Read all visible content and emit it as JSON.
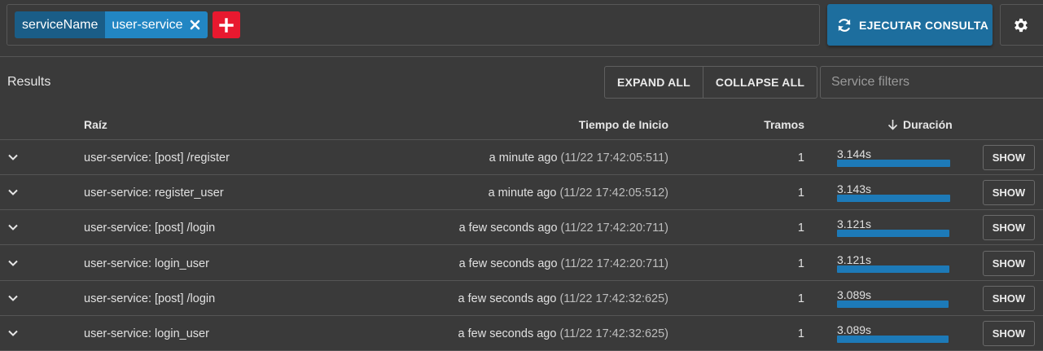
{
  "query": {
    "chip_key": "serviceName",
    "chip_value": "user-service"
  },
  "run_button": {
    "label": "EJECUTAR CONSULTA"
  },
  "results": {
    "label": "Results",
    "expand_all": "EXPAND ALL",
    "collapse_all": "COLLAPSE ALL",
    "service_filter_placeholder": "Service filters"
  },
  "table": {
    "headers": {
      "root": "Raíz",
      "start": "Tiempo de Inicio",
      "spans": "Tramos",
      "duration": "Duración"
    },
    "show_label": "SHOW",
    "rows": [
      {
        "root": "user-service: [post] /register",
        "relative": "a minute ago",
        "timestamp": "(11/22 17:42:05:511)",
        "spans": "1",
        "duration": "3.144s",
        "duration_fraction": 1.0
      },
      {
        "root": "user-service: register_user",
        "relative": "a minute ago",
        "timestamp": "(11/22 17:42:05:512)",
        "spans": "1",
        "duration": "3.143s",
        "duration_fraction": 0.9997
      },
      {
        "root": "user-service: [post] /login",
        "relative": "a few seconds ago",
        "timestamp": "(11/22 17:42:20:711)",
        "spans": "1",
        "duration": "3.121s",
        "duration_fraction": 0.9927
      },
      {
        "root": "user-service: login_user",
        "relative": "a few seconds ago",
        "timestamp": "(11/22 17:42:20:711)",
        "spans": "1",
        "duration": "3.121s",
        "duration_fraction": 0.9927
      },
      {
        "root": "user-service: [post] /login",
        "relative": "a few seconds ago",
        "timestamp": "(11/22 17:42:32:625)",
        "spans": "1",
        "duration": "3.089s",
        "duration_fraction": 0.9825
      },
      {
        "root": "user-service: login_user",
        "relative": "a few seconds ago",
        "timestamp": "(11/22 17:42:32:625)",
        "spans": "1",
        "duration": "3.089s",
        "duration_fraction": 0.9825
      }
    ]
  },
  "colors": {
    "background": "#3a3a3a",
    "chip_key": "#1a5d87",
    "chip_value": "#2286c3",
    "add_button": "#e8192f",
    "primary_button": "#1d6e9e",
    "duration_bar": "#1d7ab8"
  },
  "icons": {
    "run": "refresh-icon",
    "settings": "gear-icon",
    "add": "plus-icon",
    "remove": "close-icon",
    "expand": "chevron-down-icon",
    "sort": "arrow-down-icon"
  }
}
